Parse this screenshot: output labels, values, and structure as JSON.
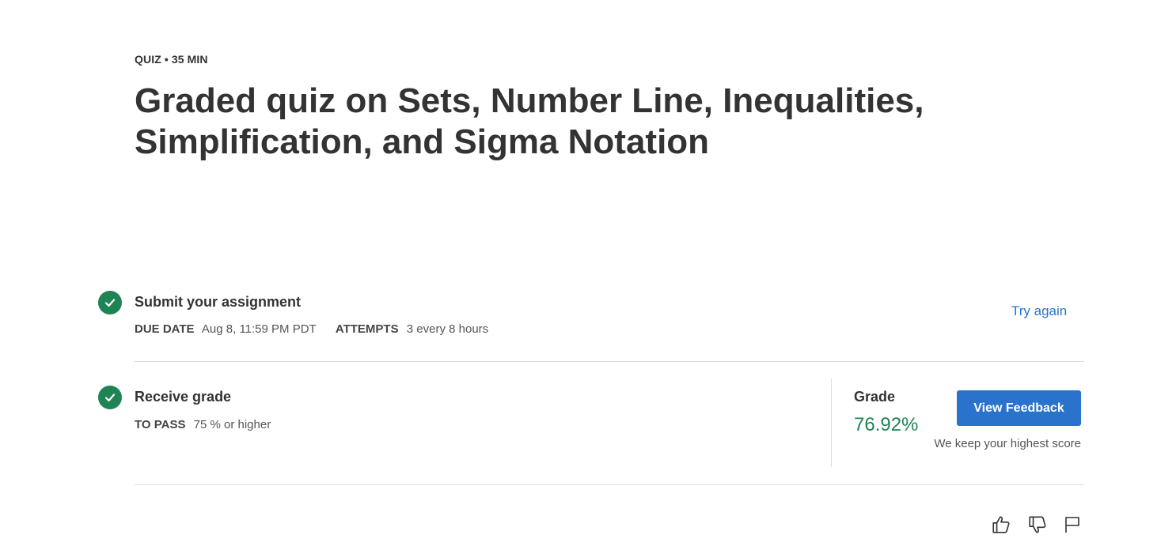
{
  "header": {
    "eyebrow": "QUIZ • 35 MIN",
    "title": "Graded quiz on Sets, Number Line, Inequalities, Simplification, and Sigma Notation"
  },
  "submit": {
    "title": "Submit your assignment",
    "due_label": "DUE DATE",
    "due_value": "Aug 8, 11:59 PM PDT",
    "attempts_label": "ATTEMPTS",
    "attempts_value": "3 every 8 hours",
    "try_again": "Try again",
    "status_icon": "check-icon"
  },
  "receive": {
    "title": "Receive grade",
    "pass_label": "TO PASS",
    "pass_value": "75 % or higher",
    "grade_label": "Grade",
    "grade_value": "76.92%",
    "feedback_button": "View Feedback",
    "note": "We keep your highest score",
    "status_icon": "check-icon"
  },
  "footer_icons": [
    "thumbs-up-icon",
    "thumbs-down-icon",
    "flag-icon"
  ],
  "colors": {
    "accent": "#2a73cc",
    "success": "#1f8354",
    "text": "#333333",
    "divider": "#dcdcdc"
  }
}
